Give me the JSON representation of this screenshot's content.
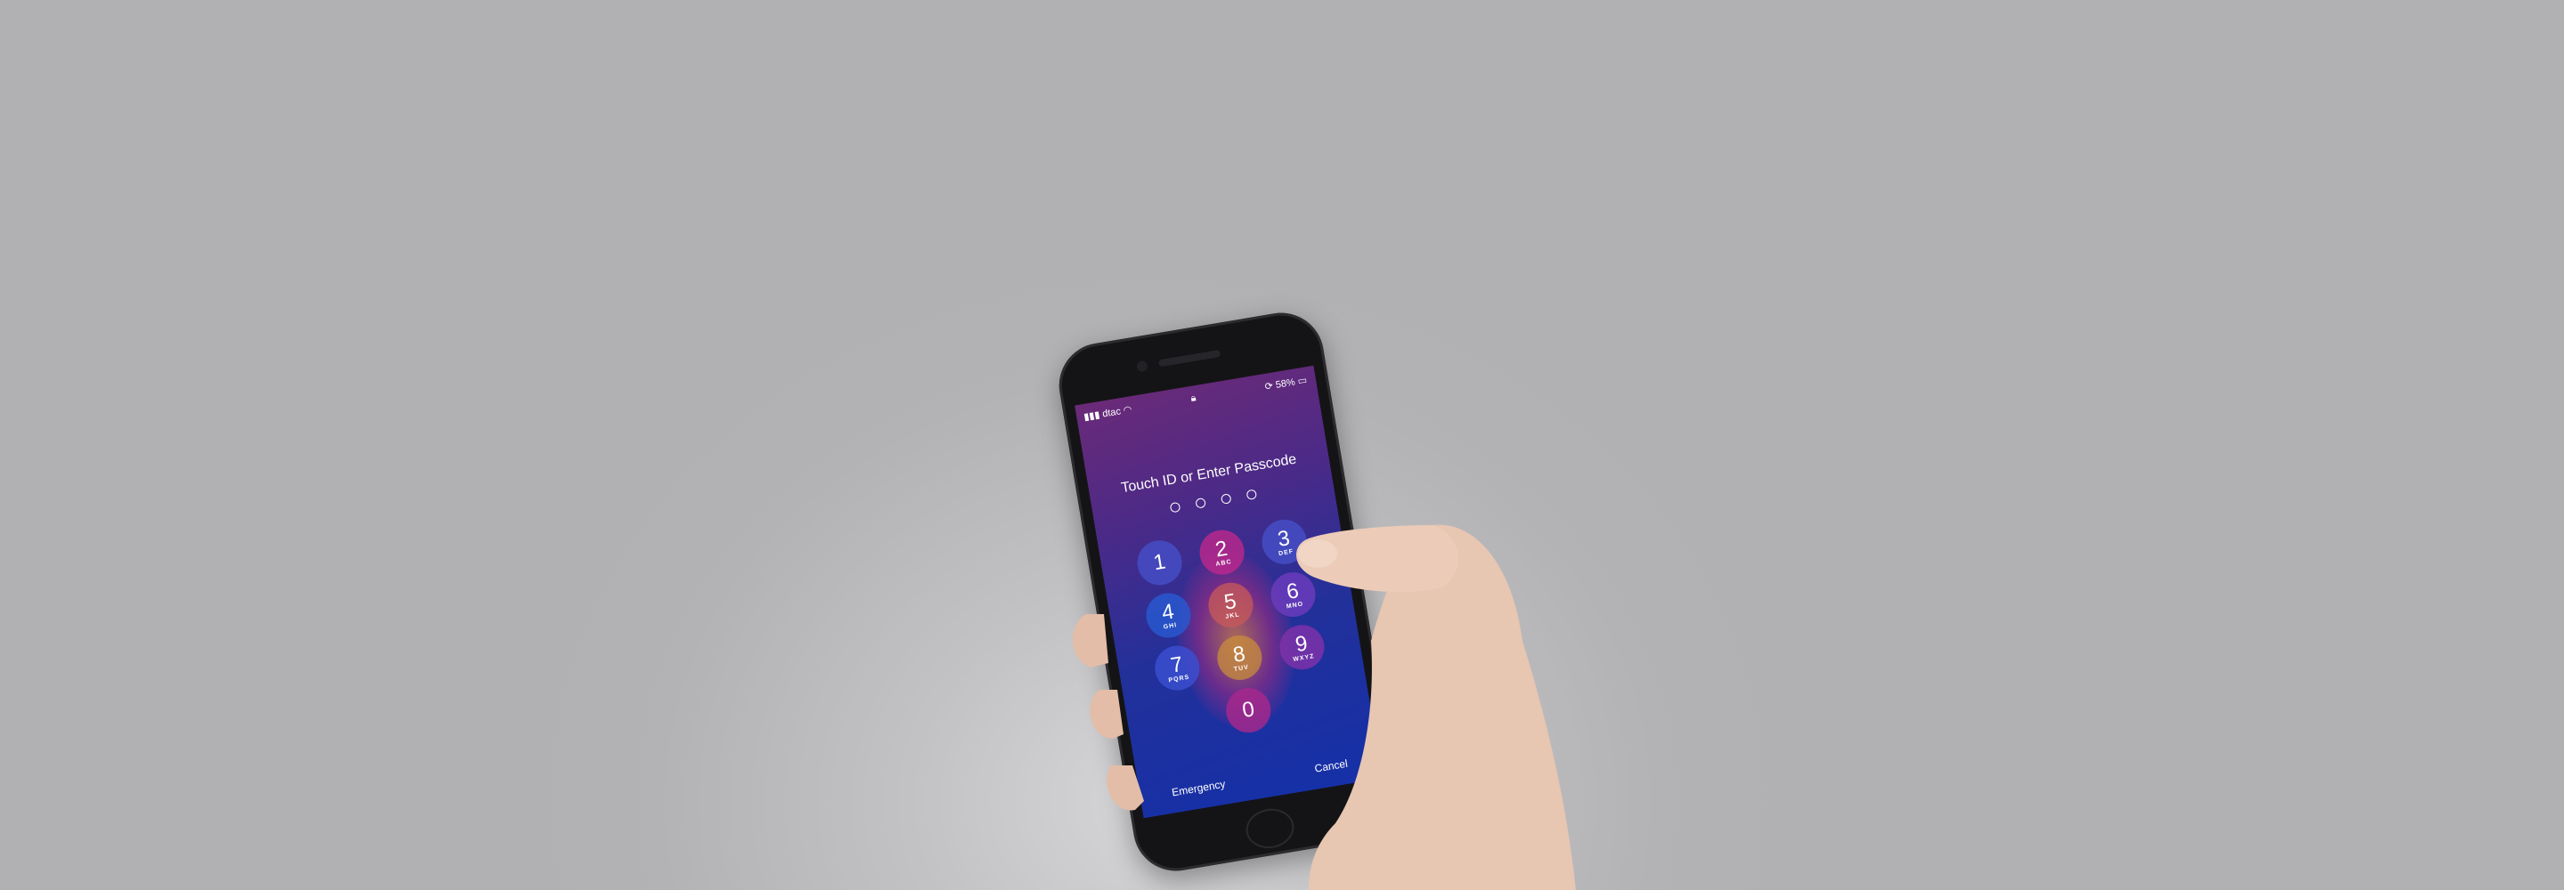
{
  "status_bar": {
    "carrier": "dtac",
    "battery": "58%",
    "icons": [
      "signal-icon",
      "wifi-icon",
      "lock-icon",
      "rotation-lock-icon",
      "battery-icon"
    ]
  },
  "lock_screen": {
    "prompt": "Touch ID or Enter Passcode",
    "passcode_length": 4,
    "keys": [
      {
        "digit": "1",
        "letters": ""
      },
      {
        "digit": "2",
        "letters": "ABC"
      },
      {
        "digit": "3",
        "letters": "DEF"
      },
      {
        "digit": "4",
        "letters": "GHI"
      },
      {
        "digit": "5",
        "letters": "JKL"
      },
      {
        "digit": "6",
        "letters": "MNO"
      },
      {
        "digit": "7",
        "letters": "PQRS"
      },
      {
        "digit": "8",
        "letters": "TUV"
      },
      {
        "digit": "9",
        "letters": "WXYZ"
      },
      {
        "digit": "0",
        "letters": ""
      }
    ],
    "emergency": "Emergency",
    "cancel": "Cancel"
  },
  "colors": {
    "background": "#b3b3b5",
    "screen_top": "#6a2a78",
    "screen_bottom": "#1530a8",
    "skin": "#e9c9b6"
  }
}
